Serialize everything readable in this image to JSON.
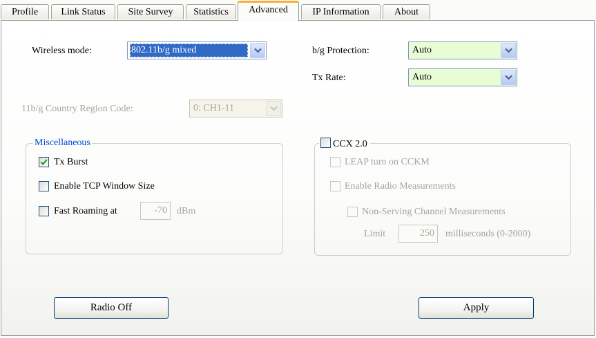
{
  "tabs": [
    "Profile",
    "Link Status",
    "Site Survey",
    "Statistics",
    "Advanced",
    "IP Information",
    "About"
  ],
  "active_tab": "Advanced",
  "wireless_mode": {
    "label": "Wireless mode:",
    "value": "802.11b/g mixed"
  },
  "bg_protection": {
    "label": "b/g Protection:",
    "value": "Auto"
  },
  "tx_rate": {
    "label": "Tx Rate:",
    "value": "Auto"
  },
  "country_region": {
    "label": "11b/g Country Region Code:",
    "value": "0: CH1-11"
  },
  "misc": {
    "title": "Miscellaneous",
    "tx_burst": {
      "label": "Tx Burst",
      "checked": true
    },
    "tcp_window": {
      "label": "Enable TCP Window Size",
      "checked": false
    },
    "fast_roaming": {
      "label": "Fast Roaming at",
      "value": "-70",
      "unit": "dBm",
      "checked": false
    }
  },
  "ccx": {
    "title": "CCX 2.0",
    "checked": false,
    "leap": {
      "label": "LEAP turn on CCKM"
    },
    "radio_meas": {
      "label": "Enable Radio Measurements"
    },
    "non_serving": {
      "label": "Non-Serving Channel Measurements"
    },
    "limit": {
      "label": "Limit",
      "value": "250",
      "unit": "milliseconds (0-2000)"
    }
  },
  "buttons": {
    "radio_off": "Radio Off",
    "apply": "Apply"
  },
  "colors": {
    "accent": "#316ac5",
    "active_tab": "#f5b03c",
    "combo_green": "#e8fcd6",
    "legend_blue": "#0046d5"
  },
  "icons": {
    "dropdown": "chevron-down-icon",
    "checkmark": "checkmark-icon"
  }
}
